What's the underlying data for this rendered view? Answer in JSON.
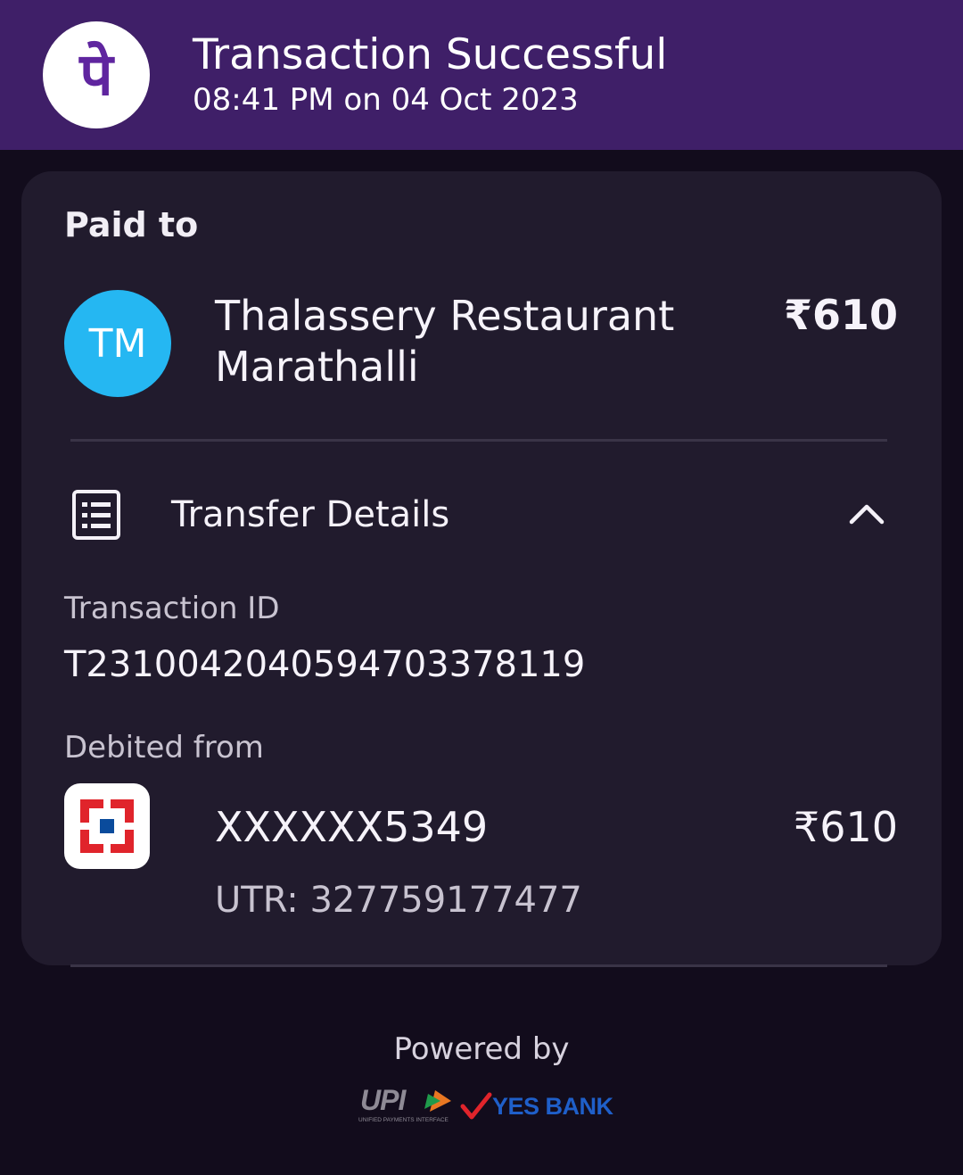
{
  "header": {
    "title": "Transaction Successful",
    "subtitle": "08:41 PM on 04 Oct 2023",
    "app_logo_icon": "phonepe-logo-icon",
    "app_logo_glyph": "पे"
  },
  "payment": {
    "paid_to_label": "Paid to",
    "payee_initials": "TM",
    "payee_name": "Thalassery Restaurant Marathalli",
    "amount": "₹610"
  },
  "transfer_details": {
    "title": "Transfer Details",
    "icon": "receipt-list-icon",
    "collapse_icon": "chevron-up-icon",
    "transaction_id_label": "Transaction ID",
    "transaction_id": "T2310042040594703378119",
    "debited_from_label": "Debited from",
    "bank_icon": "hdfc-bank-logo-icon",
    "account": "XXXXXX5349",
    "debited_amount": "₹610",
    "utr": "UTR: 327759177477"
  },
  "footer": {
    "powered_by": "Powered by",
    "upi_text": "UPI",
    "upi_subtext": "UNIFIED PAYMENTS INTERFACE",
    "bank_partner": "YES BANK"
  },
  "colors": {
    "header_bg": "#3f1f68",
    "page_bg": "#120c1c",
    "card_bg": "#211b2d",
    "avatar_bg": "#25b7f2",
    "phonepe_purple": "#5f259f",
    "hdfc_red": "#e0242b",
    "hdfc_blue": "#0a4b9c",
    "yes_bank_blue": "#1f5fc9"
  }
}
